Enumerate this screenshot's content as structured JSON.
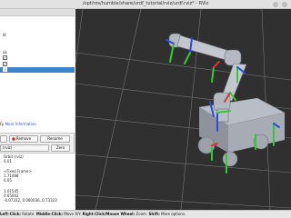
{
  "window": {
    "title": "/opt/ros/humble/share/urdf_tutorial/rviz/urdf.rviz* - RViz"
  },
  "displays": {
    "rows": [
      {
        "label": "lit",
        "checked": false,
        "selected": false
      },
      {
        "label": "ok",
        "checked": false,
        "selected": false
      },
      {
        "label": "",
        "checked": true,
        "selected": false
      },
      {
        "label": "",
        "checked": true,
        "selected": false
      },
      {
        "label": "",
        "checked": true,
        "selected": true
      }
    ],
    "help_prefix": "Fy",
    "help_link": "More Information",
    "remove_label": "Remove",
    "rename_label": "Rename"
  },
  "views": {
    "type_value": "(rviz)",
    "zero_label": "Zero",
    "rows": [
      "Orbit (rviz)",
      "0.01",
      "",
      "<Fixed Frame>",
      "1.71488",
      "0.05",
      "",
      "1.01545",
      "0.65002",
      "-0.07332, 0.000036, 0.73323"
    ],
    "remove_label": "Remove",
    "rename_label": "Rename"
  },
  "status": {
    "left_click": "Left-Click:",
    "left_action": " Rotate. ",
    "middle_click": "Middle-Click:",
    "middle_action": " Move X/Y. ",
    "right_click": "Right-Click/Mouse Wheel:",
    "right_action": " Zoom. ",
    "shift": "Shift:",
    "shift_action": " More options."
  }
}
